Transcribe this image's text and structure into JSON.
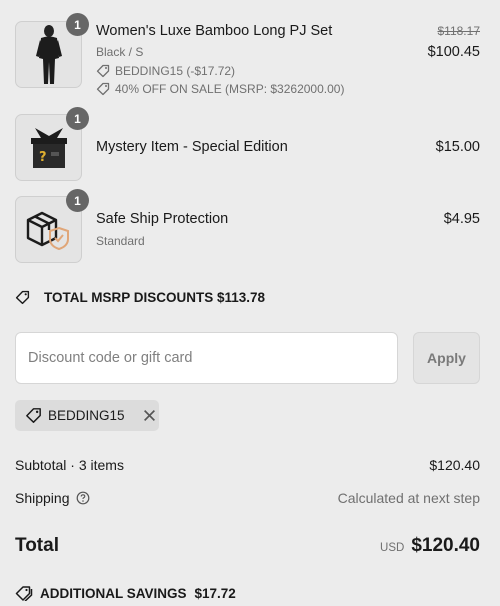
{
  "items": [
    {
      "quantity": "1",
      "name": "Women's Luxe Bamboo Long PJ Set",
      "variant": "Black / S",
      "original_price": "$118.17",
      "price": "$100.45",
      "discounts": [
        "BEDDING15 (-$17.72)",
        "40% OFF ON SALE (MSRP: $3262000.00)"
      ]
    },
    {
      "quantity": "1",
      "name": "Mystery Item - Special Edition",
      "price": "$15.00"
    },
    {
      "quantity": "1",
      "name": "Safe Ship Protection",
      "variant": "Standard",
      "price": "$4.95"
    }
  ],
  "msrp_discounts": "TOTAL MSRP DISCOUNTS $113.78",
  "discount": {
    "placeholder": "Discount code or gift card",
    "apply_label": "Apply",
    "applied_code": "BEDDING15"
  },
  "summary": {
    "subtotal_label": "Subtotal · 3 items",
    "subtotal_value": "$120.40",
    "shipping_label": "Shipping",
    "shipping_value": "Calculated at next step",
    "total_label": "Total",
    "currency": "USD",
    "total_value": "$120.40"
  },
  "additional_savings": {
    "label": "ADDITIONAL SAVINGS",
    "value": "$17.72"
  },
  "icons": {
    "tag": "tag-icon",
    "close": "close-icon",
    "help": "help-icon"
  }
}
